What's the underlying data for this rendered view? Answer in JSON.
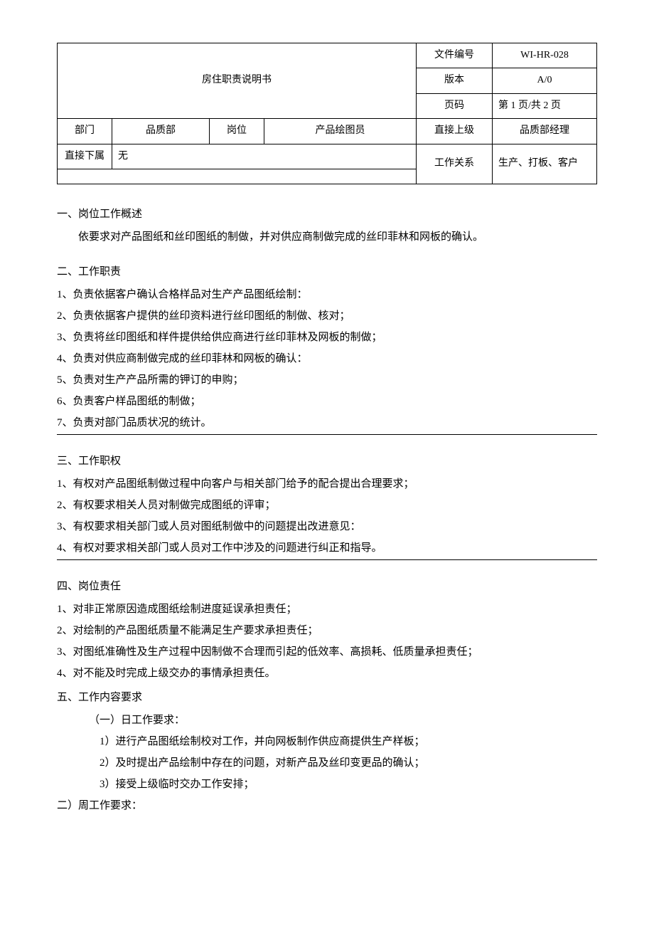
{
  "header": {
    "title": "房住职责说明书",
    "doc_no_label": "文件编号",
    "doc_no_value": "WI-HR-028",
    "version_label": "版本",
    "version_value": "A/0",
    "page_label": "页码",
    "page_value": "第 1 页/共 2 页",
    "dept_label": "部门",
    "dept_value": "品质部",
    "position_label": "岗位",
    "position_value": "产品绘图员",
    "supervisor_label": "直接上级",
    "supervisor_value": "品质部经理",
    "subordinate_label": "直接下属",
    "subordinate_value": "无",
    "relation_label": "工作关系",
    "relation_value": "生产、打板、客户"
  },
  "sec1": {
    "heading": "一、岗位工作概述",
    "body": "依要求对产品图纸和丝印图纸的制做，并对供应商制做完成的丝印菲林和网板的确认。"
  },
  "sec2": {
    "heading": "二、工作职责",
    "items": [
      "1、负责依据客户确认合格样品对生产产品图纸绘制：",
      "2、负责依据客户提供的丝印资料进行丝印图纸的制做、核对；",
      "3、负责将丝印图纸和样件提供给供应商进行丝印菲林及网板的制做；",
      "4、负责对供应商制做完成的丝印菲林和网板的确认：",
      "5、负责对生产产品所需的钾订的申购；",
      "6、负责客户样品图纸的制做；",
      "7、负责对部门品质状况的统计。"
    ]
  },
  "sec3": {
    "heading": "三、工作职权",
    "items": [
      "1、有权对产品图纸制做过程中向客户与相关部门给予的配合提出合理要求；",
      "2、有权要求相关人员对制做完成图纸的评审；",
      "3、有权要求相关部门或人员对图纸制做中的问题提出改进意见：",
      "4、有权对要求相关部门或人员对工作中涉及的问题进行纠正和指导。"
    ]
  },
  "sec4": {
    "heading": "四、岗位责任",
    "items": [
      "1、对非正常原因造成图纸绘制进度延误承担责任；",
      "2、对绘制的产品图纸质量不能满足生产要求承担责任；",
      "3、对图纸准确性及生产过程中因制做不合理而引起的低效率、高损耗、低质量承担责任；",
      "4、对不能及时完成上级交办的事情承担责任。"
    ]
  },
  "sec5": {
    "heading": "五、工作内容要求",
    "sub1_heading": "（一）日工作要求：",
    "sub1_items": [
      "1）进行产品图纸绘制校对工作，并向网板制作供应商提供生产样板；",
      "2）及时提出产品绘制中存在的问题，对新产品及丝印变更品的确认；",
      "3）接受上级临时交办工作安排；"
    ],
    "sub2_heading": "二）周工作要求："
  }
}
